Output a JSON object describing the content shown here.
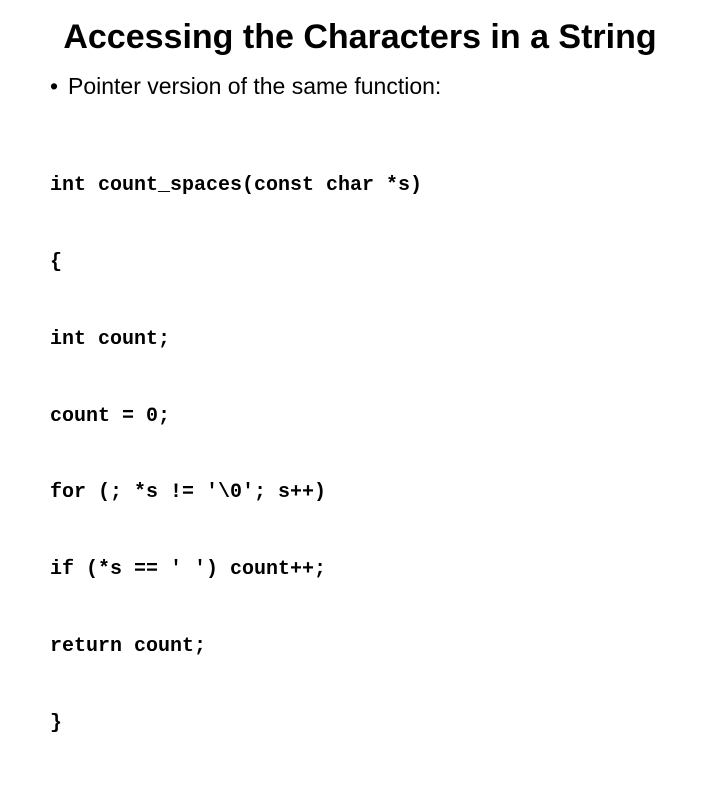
{
  "title": "Accessing the Characters in a String",
  "bullet": {
    "marker": "•",
    "text": "Pointer version of the same function:"
  },
  "code": {
    "l1": "int count_spaces(const char *s)",
    "l2": "{",
    "l3": "int count;",
    "l4": "count = 0;",
    "l5": "for (; *s != '\\0'; s++)",
    "l6": "if (*s == ' ') count++;",
    "l7": "return count;",
    "l8": "}"
  }
}
